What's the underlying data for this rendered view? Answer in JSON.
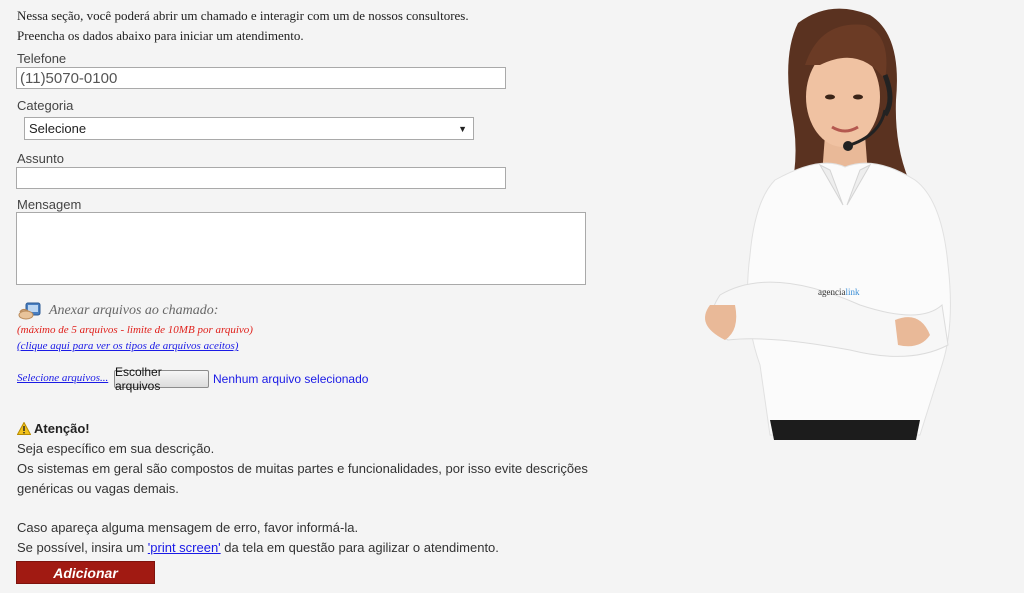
{
  "intro": {
    "line1": "Nessa seção, você poderá abrir um chamado e interagir com um de nossos consultores.",
    "line2": "Preencha os dados abaixo para iniciar um atendimento."
  },
  "form": {
    "telefone_label": "Telefone",
    "telefone_value": "(11)5070-0100",
    "categoria_label": "Categoria",
    "categoria_selected": "Selecione",
    "assunto_label": "Assunto",
    "assunto_value": "",
    "mensagem_label": "Mensagem",
    "mensagem_value": ""
  },
  "attach": {
    "title": "Anexar arquivos ao chamado:",
    "limit_note": "(máximo de 5 arquivos - limite de 10MB por arquivo)",
    "types_link": "(clique aqui para ver os tipos de arquivos aceitos)",
    "select_link": "Selecione arquivos...",
    "choose_button": "Escolher arquivos",
    "no_file": "Nenhum arquivo selecionado"
  },
  "attention": {
    "title": "Atenção!",
    "line1": "Seja específico em sua descrição.",
    "line2": "Os sistemas em geral são compostos de muitas partes e funcionalidades, por isso evite descrições",
    "line3": "genéricas ou vagas demais.",
    "line4": "Caso apareça alguma mensagem de erro, favor informá-la.",
    "line5_pre": "Se possível, insira um ",
    "line5_link": "'print screen'",
    "line5_post": " da tela em questão para agilizar o atendimento."
  },
  "submit_label": "Adicionar",
  "photo": {
    "badge_text_1": "agencia",
    "badge_text_2": "link"
  },
  "icons": {
    "attach": "attach-files-icon",
    "warning": "warning-icon",
    "dropdown": "chevron-down-icon"
  }
}
